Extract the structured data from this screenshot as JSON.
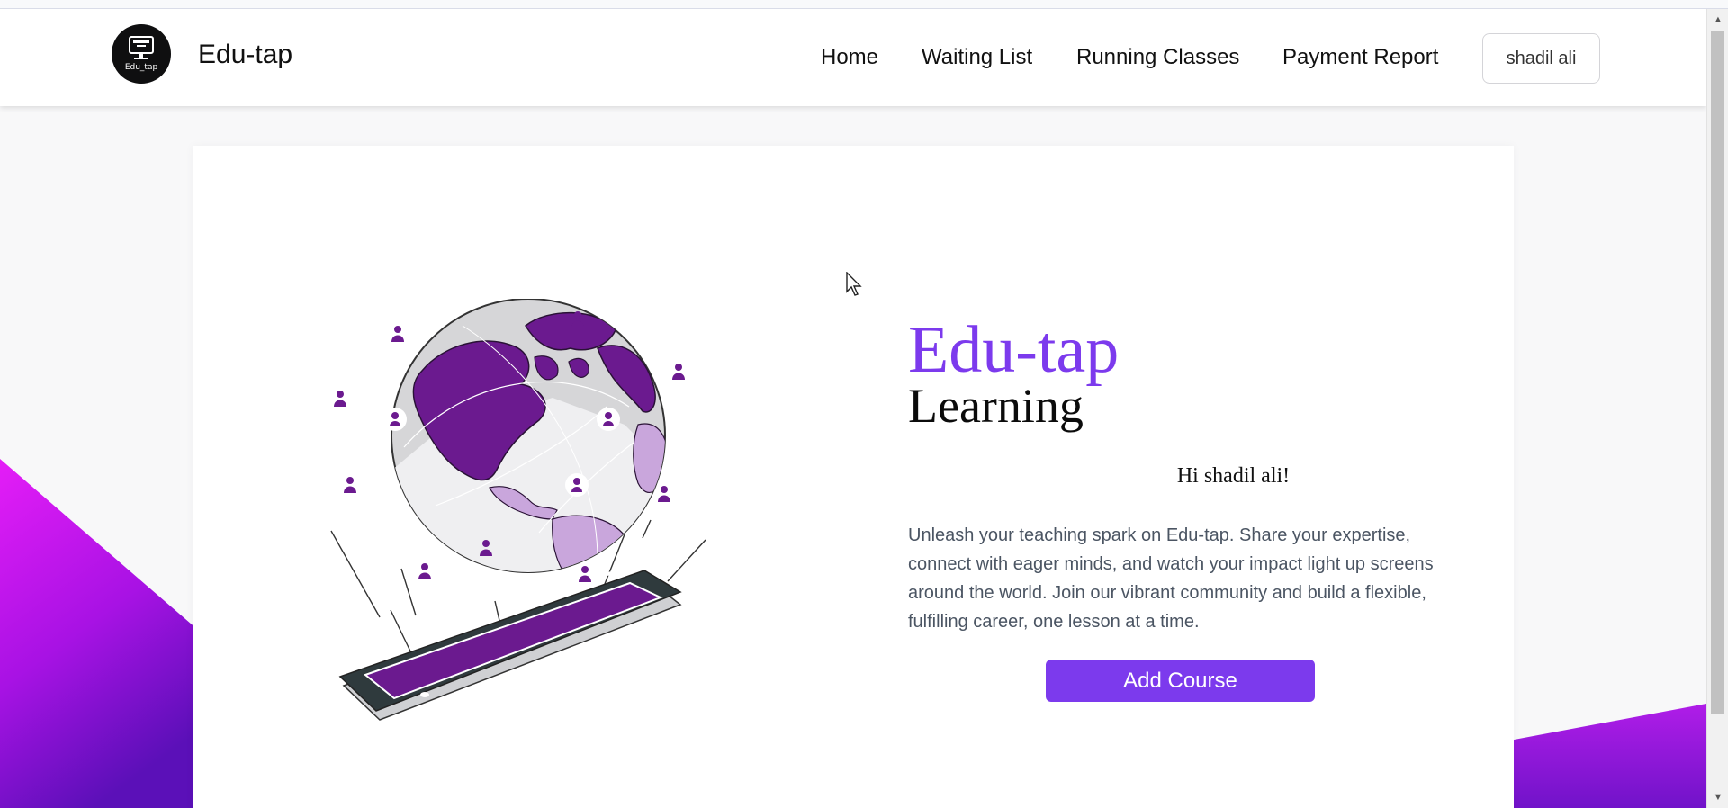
{
  "navbar": {
    "logo_text": "Edu_tap",
    "brand": "Edu-tap",
    "links": [
      "Home",
      "Waiting List",
      "Running Classes",
      "Payment Report"
    ],
    "user_button": "shadil ali"
  },
  "hero": {
    "title_line1": "Edu-tap",
    "title_line2": "Learning",
    "greeting": "Hi shadil ali!",
    "description": "Unleash your teaching spark on Edu-tap. Share your expertise, connect with eager minds, and watch your impact light up screens around the world. Join our vibrant community and build a flexible, fulfilling career, one lesson at a time.",
    "add_button": "Add Course"
  },
  "colors": {
    "accent": "#7c3aed",
    "illustration_purple": "#6b1a8f",
    "gradient_top": "#e51df7",
    "gradient_bottom": "#5b10b8"
  },
  "icons": {
    "logo": "monitor-icon",
    "illustration": "globe-tablet-illustration",
    "cursor": "mouse-cursor-icon"
  }
}
